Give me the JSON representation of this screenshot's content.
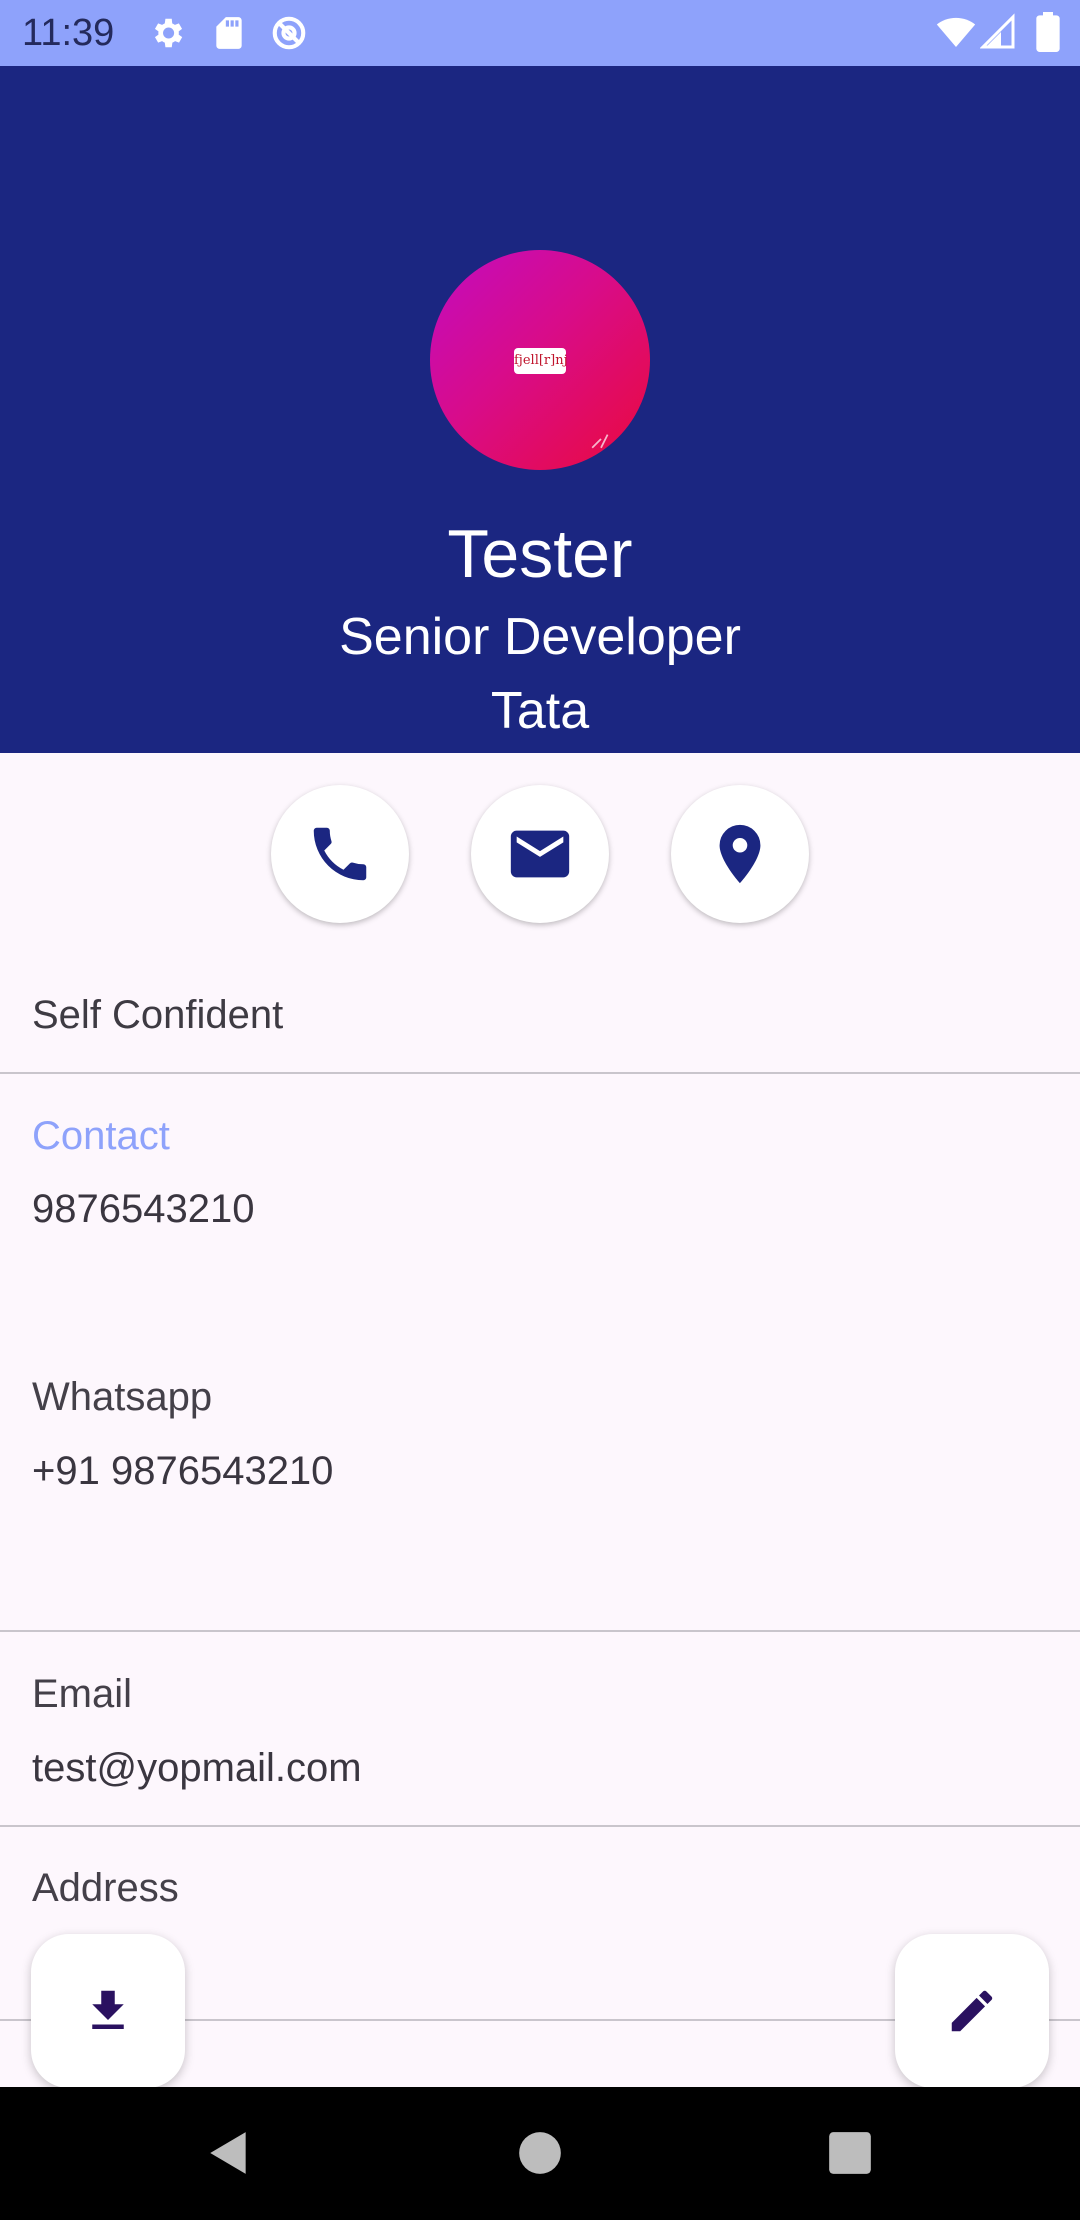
{
  "status_bar": {
    "time": "11:39",
    "left_icons": [
      "gear-icon",
      "sd-card-icon",
      "at-sign-icon"
    ],
    "right_icons": [
      "wifi-icon",
      "cell-signal-icon",
      "battery-icon"
    ]
  },
  "profile": {
    "avatar_chip_text": "fjell[r]nj",
    "name": "Tester",
    "role": "Senior Developer",
    "company": "Tata"
  },
  "actions": [
    "phone-icon",
    "email-icon",
    "location-icon"
  ],
  "tagline": "Self Confident",
  "contact": {
    "label": "Contact",
    "phone": "9876543210",
    "whatsapp_label": "Whatsapp",
    "whatsapp": "+91 9876543210"
  },
  "email": {
    "label": "Email",
    "value": "test@yopmail.com"
  },
  "address": {
    "label": "Address"
  },
  "fabs": [
    "download-icon",
    "edit-icon"
  ],
  "nav": [
    "back-icon",
    "home-icon",
    "recents-icon"
  ],
  "colors": {
    "status_bar": "#8ea2fb",
    "header": "#1b2681",
    "accent": "#8ea2fb",
    "icon": "#1b2681",
    "fab_icon": "#2a1160"
  }
}
